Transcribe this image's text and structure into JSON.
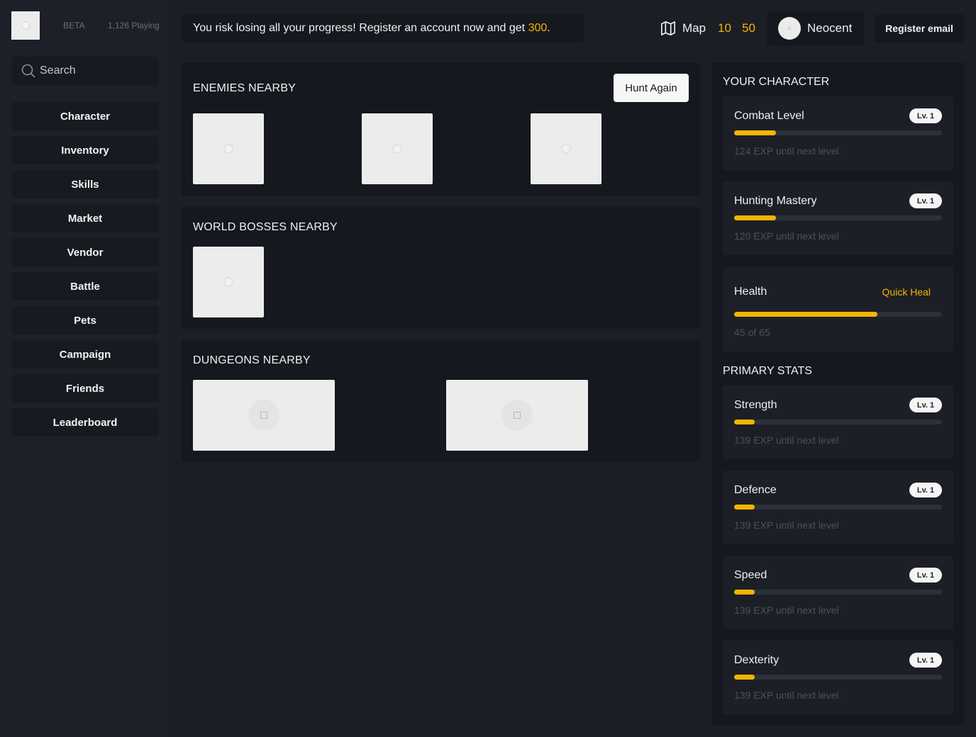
{
  "app": {
    "beta_label": "BETA",
    "players_online": "1,126 Playing"
  },
  "search": {
    "placeholder": "Search"
  },
  "sidebar": {
    "items": [
      {
        "label": "Character"
      },
      {
        "label": "Inventory"
      },
      {
        "label": "Skills"
      },
      {
        "label": "Market"
      },
      {
        "label": "Vendor"
      },
      {
        "label": "Battle"
      },
      {
        "label": "Pets"
      },
      {
        "label": "Campaign"
      },
      {
        "label": "Friends"
      },
      {
        "label": "Leaderboard"
      }
    ]
  },
  "header": {
    "banner_text": "You risk losing all your progress! Register an account now and get ",
    "banner_reward": "300",
    "banner_end": ".",
    "map_label": "Map",
    "currency_1": "10",
    "currency_2": "50",
    "username": "Neocent",
    "register_label": "Register email"
  },
  "enemies": {
    "title": "ENEMIES NEARBY",
    "hunt_label": "Hunt Again"
  },
  "bosses": {
    "title": "WORLD BOSSES NEARBY"
  },
  "dungeons": {
    "title": "DUNGEONS NEARBY"
  },
  "character": {
    "title": "YOUR CHARACTER",
    "combat": {
      "label": "Combat Level",
      "level": "Lv. 1",
      "progress": 0.2,
      "note": "124 EXP until next level"
    },
    "hunting": {
      "label": "Hunting Mastery",
      "level": "Lv. 1",
      "progress": 0.2,
      "note": "120 EXP until next level"
    },
    "health": {
      "label": "Health",
      "action": "Quick Heal",
      "progress": 0.69,
      "note": "45 of 65"
    }
  },
  "primary_stats": {
    "title": "PRIMARY STATS",
    "items": [
      {
        "label": "Strength",
        "level": "Lv. 1",
        "progress": 0.1,
        "note": "139 EXP until next level"
      },
      {
        "label": "Defence",
        "level": "Lv. 1",
        "progress": 0.1,
        "note": "139 EXP until next level"
      },
      {
        "label": "Speed",
        "level": "Lv. 1",
        "progress": 0.1,
        "note": "139 EXP until next level"
      },
      {
        "label": "Dexterity",
        "level": "Lv. 1",
        "progress": 0.1,
        "note": "139 EXP until next level"
      }
    ]
  },
  "colors": {
    "accent": "#f5b400",
    "background": "#1b1e25",
    "panel": "#15181e"
  }
}
